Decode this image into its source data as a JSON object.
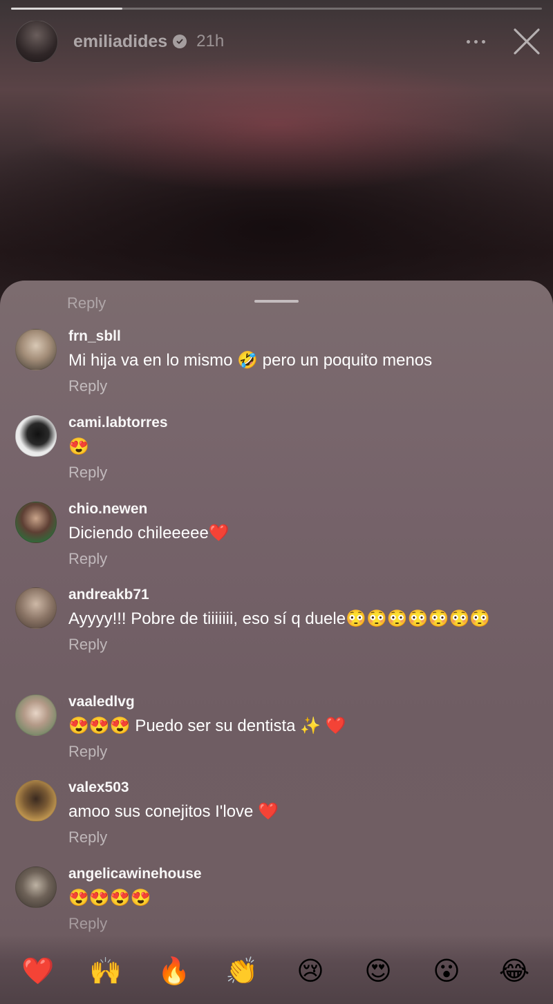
{
  "story": {
    "username": "emiliadides",
    "time": "21h",
    "progress": 0.21
  },
  "comments_sheet": {
    "reply_label_top": "Reply",
    "comments": [
      {
        "username": "frn_sbll",
        "text": "Mi hija va en lo mismo 🤣 pero un poquito menos",
        "reply": "Reply"
      },
      {
        "username": "cami.labtorres",
        "text": "😍",
        "reply": "Reply"
      },
      {
        "username": "chio.newen",
        "text": "Diciendo chileeeee❤️",
        "reply": "Reply"
      },
      {
        "username": "andreakb71",
        "text": "Ayyyy!!! Pobre de tiiiiiii, eso sí q duele😳😳😳😳😳😳😳",
        "reply": "Reply"
      },
      {
        "username": "vaaledlvg",
        "text": "😍😍😍 Puedo ser su dentista ✨ ❤️",
        "reply": "Reply"
      },
      {
        "username": "valex503",
        "text": "amoo sus conejitos I'love ❤️",
        "reply": "Reply"
      },
      {
        "username": "angelicawinehouse",
        "text": "😍😍😍😍",
        "reply": "Reply"
      }
    ]
  },
  "reactions": [
    "❤️",
    "🙌",
    "🔥",
    "👏",
    "😢",
    "😍",
    "😮",
    "😂"
  ],
  "icons": {
    "verified": "verified-badge-icon",
    "more": "more-options-icon",
    "close": "close-icon"
  }
}
